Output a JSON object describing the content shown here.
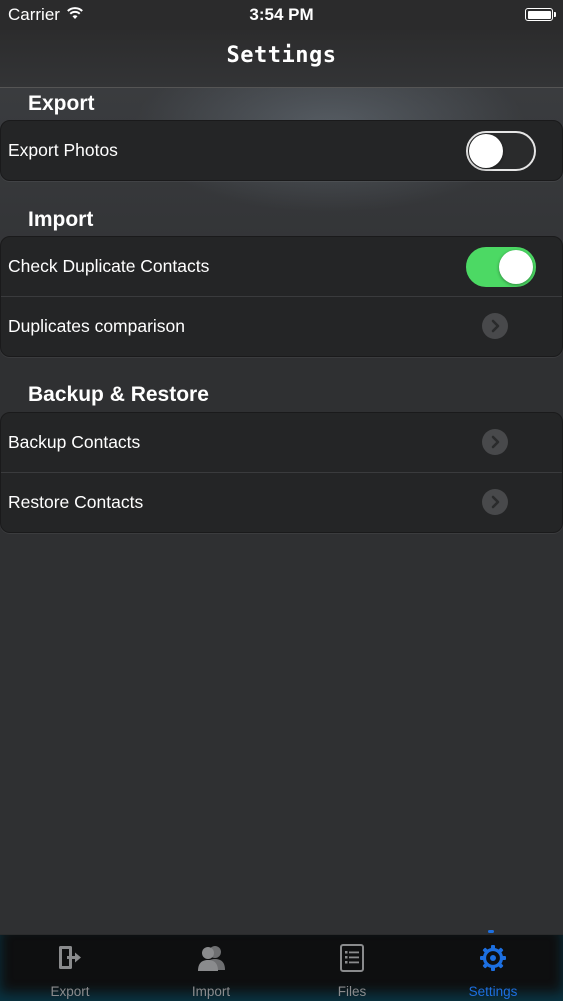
{
  "status_bar": {
    "carrier": "Carrier",
    "time": "3:54 PM"
  },
  "nav": {
    "title": "Settings"
  },
  "sections": {
    "export": {
      "header": "Export",
      "rows": [
        {
          "label": "Export Photos",
          "toggle": "off"
        }
      ]
    },
    "import": {
      "header": "Import",
      "rows": [
        {
          "label": "Check Duplicate Contacts",
          "toggle": "on"
        },
        {
          "label": "Duplicates comparison"
        }
      ]
    },
    "backup": {
      "header": "Backup & Restore",
      "rows": [
        {
          "label": "Backup Contacts"
        },
        {
          "label": "Restore Contacts"
        }
      ]
    }
  },
  "tab_bar": {
    "tabs": [
      {
        "label": "Export",
        "icon": "export-icon"
      },
      {
        "label": "Import",
        "icon": "contacts-icon"
      },
      {
        "label": "Files",
        "icon": "files-icon"
      },
      {
        "label": "Settings",
        "icon": "gear-icon",
        "active": true
      }
    ]
  },
  "colors": {
    "accent": "#1d6fe0",
    "toggle_on": "#4cd964",
    "background": "#2f3032"
  }
}
